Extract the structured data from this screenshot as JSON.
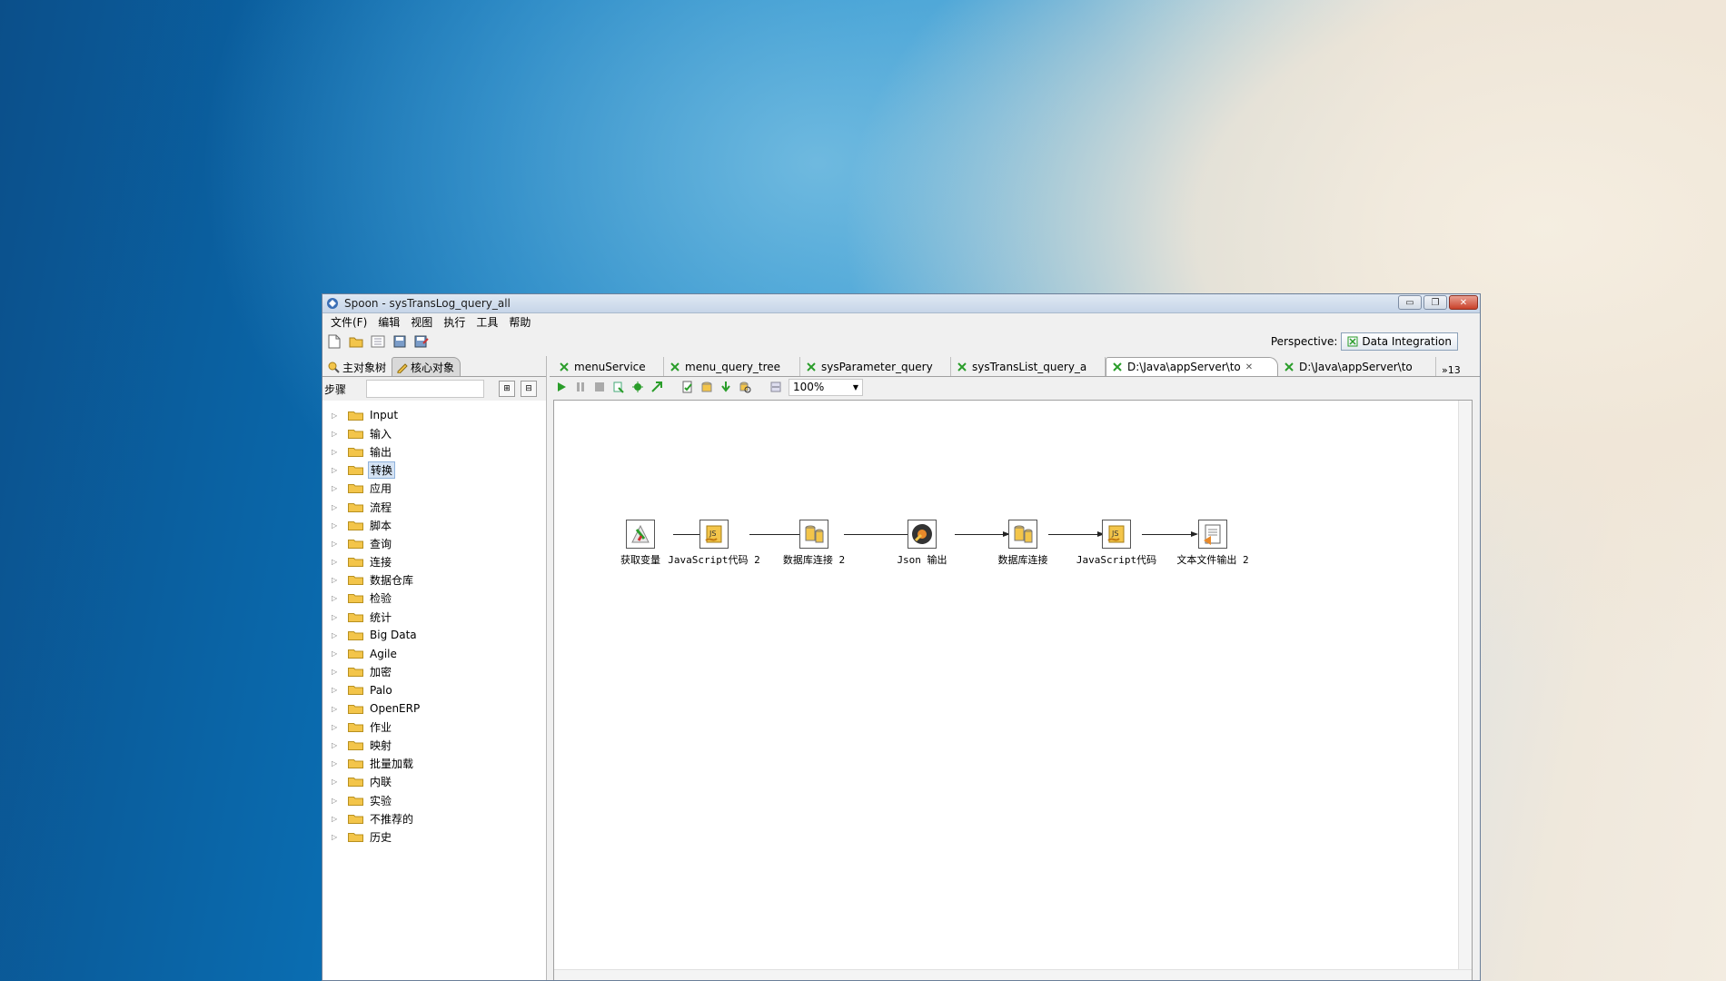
{
  "window": {
    "title": "Spoon - sysTransLog_query_all",
    "controls": {
      "minimize": "▭",
      "restore": "❐",
      "close": "✕"
    }
  },
  "menu": [
    "文件(F)",
    "编辑",
    "视图",
    "执行",
    "工具",
    "帮助"
  ],
  "perspective": {
    "label": "Perspective:",
    "value": "Data Integration"
  },
  "left_tabs": [
    "主对象树",
    "核心对象"
  ],
  "search": {
    "label": "步骤",
    "placeholder": ""
  },
  "tree": [
    "Input",
    "输入",
    "输出",
    "转换",
    "应用",
    "流程",
    "脚本",
    "查询",
    "连接",
    "数据仓库",
    "检验",
    "统计",
    "Big Data",
    "Agile",
    "加密",
    "Palo",
    "OpenERP",
    "作业",
    "映射",
    "批量加载",
    "内联",
    "实验",
    "不推荐的",
    "历史"
  ],
  "selected_tree_item": "转换",
  "doc_tabs": [
    "menuService",
    "menu_query_tree",
    "sysParameter_query",
    "sysTransList_query_a",
    "D:\\Java\\appServer\\to",
    "D:\\Java\\appServer\\to"
  ],
  "active_doc_tab": 4,
  "more_tabs": "»13",
  "zoom": "100%",
  "steps": [
    {
      "label": "获取变量",
      "icon": "get-variables-icon"
    },
    {
      "label": "JavaScript代码 2",
      "icon": "javascript-icon"
    },
    {
      "label": "数据库连接 2",
      "icon": "database-join-icon"
    },
    {
      "label": "Json 输出",
      "icon": "json-output-icon"
    },
    {
      "label": "数据库连接",
      "icon": "database-join-icon"
    },
    {
      "label": "JavaScript代码",
      "icon": "javascript-icon"
    },
    {
      "label": "文本文件输出 2",
      "icon": "text-file-output-icon"
    }
  ],
  "colors": {
    "accent_green": "#2a9d2a",
    "folder": "#f3c54a",
    "close_red": "#c9412a"
  }
}
